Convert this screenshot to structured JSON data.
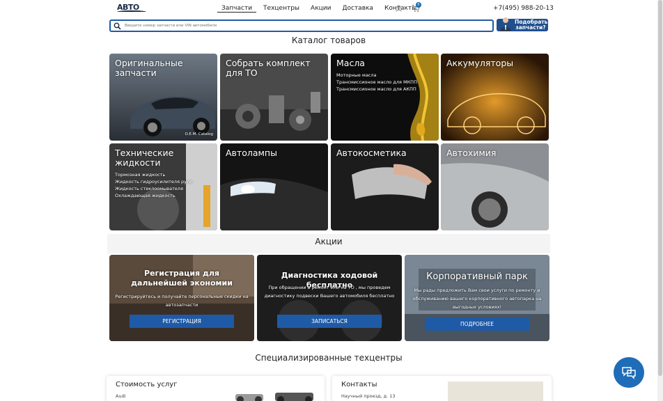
{
  "header": {
    "logo": "АВТО",
    "nav": [
      {
        "label": "Запчасти",
        "active": true
      },
      {
        "label": "Техцентры",
        "active": false
      },
      {
        "label": "Акции",
        "active": false
      },
      {
        "label": "Доставка",
        "active": false
      },
      {
        "label": "Контакты",
        "active": false
      }
    ],
    "cart_count": "0",
    "phone": "+7(495) 988-20-13",
    "icons": {
      "user": "user-icon",
      "cart": "cart-icon"
    }
  },
  "search": {
    "placeholder": "Введите номер запчасти или VIN автомобиля",
    "pick_button": "Подобрать запчасти?"
  },
  "catalog": {
    "title": "Каталог товаров",
    "tiles": [
      {
        "title": "Оригинальные запчасти",
        "sub": [],
        "note": "O.E.M. Catalog"
      },
      {
        "title": "Собрать комплект для ТО",
        "sub": [],
        "note": ""
      },
      {
        "title": "Масла",
        "sub": [
          "Моторные масла",
          "Трансмиссионое масло для МКПП",
          "Трансмиссионое масло для АКПП"
        ],
        "note": ""
      },
      {
        "title": "Аккумуляторы",
        "sub": [],
        "note": ""
      },
      {
        "title": "Технические жидкости",
        "sub": [
          "Тормозная жидкость",
          "Жидкость гидроусилителя руля",
          "Жидкость стеклоомывателя",
          "Охлаждающая жидкость"
        ],
        "note": ""
      },
      {
        "title": "Автолампы",
        "sub": [],
        "note": ""
      },
      {
        "title": "Автокосметика",
        "sub": [],
        "note": ""
      },
      {
        "title": "Автохимия",
        "sub": [],
        "note": ""
      }
    ]
  },
  "promos": {
    "title": "Акции",
    "items": [
      {
        "title": "Регистрация для дальнейшей экономии",
        "text": "Регистрируйтесь и получайте персональные скидки на автозапчасти",
        "button": "РЕГИСТРАЦИЯ"
      },
      {
        "title": "Диагностика ходовой бесплатно",
        "text": "При обращении в ремонт или на ТО , мы проведем диагностику подвески Вашего автомобиля бесплатно",
        "button": "ЗАПИСАТЬСЯ"
      },
      {
        "title": "Корпоративный парк",
        "text": "Мы рады предложить Вам свои услуги по ремонту и обслуживанию вашего корпоративного автопарка на выгодных условиях!",
        "button": "ПОДРОБНЕЕ"
      }
    ]
  },
  "techcenters": {
    "title": "Специализированные техцентры",
    "cost_card": {
      "title": "Стоимость услуг",
      "sub": "Audi"
    },
    "contacts_card": {
      "title": "Контакты",
      "sub": "Научный проезд, д. 13"
    }
  },
  "colors": {
    "accent": "#1f5aa6",
    "dark_blue": "#1f4f8e",
    "chat": "#1f6db8"
  }
}
